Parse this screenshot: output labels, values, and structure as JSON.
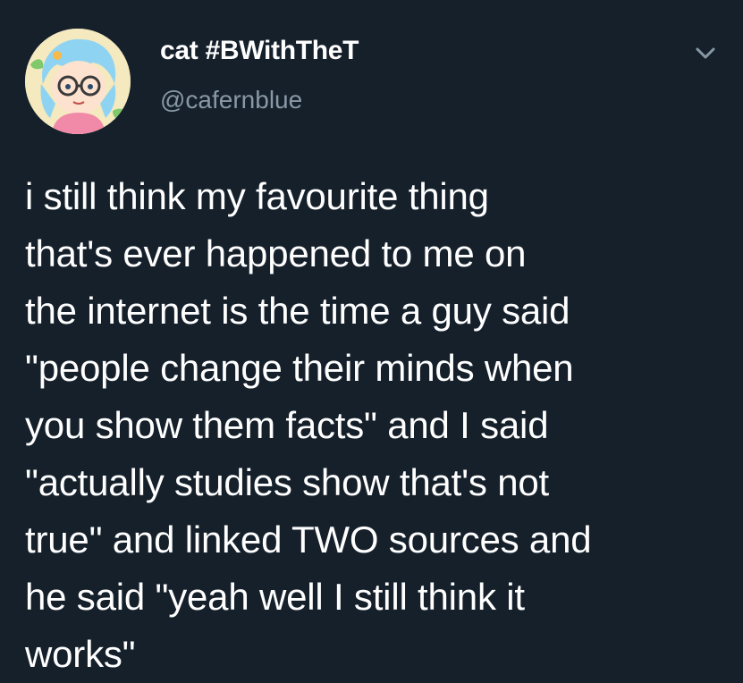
{
  "tweet": {
    "display_name": "cat #BWithTheT",
    "handle": "@cafernblue",
    "text_lines": [
      "i still think my favourite thing",
      "that's ever happened to me on",
      "the internet is the time a guy said",
      "\"people change their minds when",
      "you show them facts\" and I said",
      "\"actually studies show that's not",
      "true\" and linked TWO sources and",
      "he said \"yeah well I still think it",
      "works\""
    ],
    "avatar_icon": "cartoon-avatar",
    "menu_icon": "chevron-down-icon"
  },
  "colors": {
    "background": "#15202b",
    "text": "#ffffff",
    "secondary_text": "#8899a6"
  }
}
